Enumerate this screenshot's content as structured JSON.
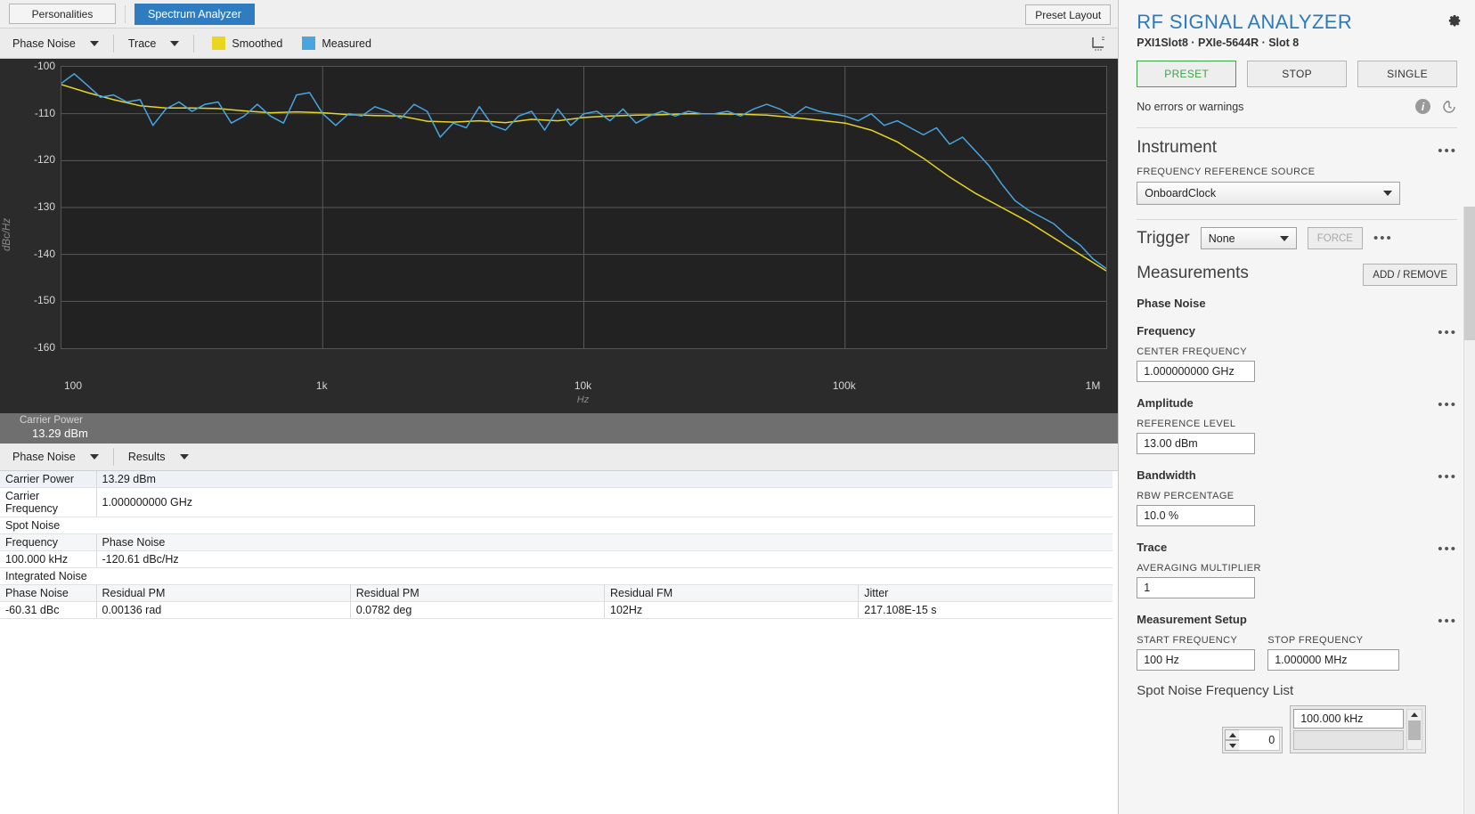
{
  "topbar": {
    "personalities_label": "Personalities",
    "spectrum_analyzer_label": "Spectrum Analyzer",
    "preset_layout_label": "Preset Layout"
  },
  "chart_toolbar": {
    "measurement_dropdown": "Phase Noise",
    "trace_dropdown": "Trace",
    "legend": [
      {
        "label": "Smoothed",
        "color": "#e8d621"
      },
      {
        "label": "Measured",
        "color": "#49a5e0"
      }
    ],
    "cursor_icon": "cursor-legend-icon"
  },
  "chart_data": {
    "type": "line",
    "title": "",
    "xlabel": "Hz",
    "ylabel": "dBc/Hz",
    "xscale": "log",
    "xlim": [
      100,
      1000000
    ],
    "ylim": [
      -160,
      -100
    ],
    "ytick_labels": [
      "-100",
      "-110",
      "-120",
      "-130",
      "-140",
      "-150",
      "-160"
    ],
    "yticks": [
      -100,
      -110,
      -120,
      -130,
      -140,
      -150,
      -160
    ],
    "xtick_labels": [
      "100",
      "1k",
      "10k",
      "100k",
      "1M"
    ],
    "xticks": [
      100,
      1000,
      10000,
      100000,
      1000000
    ],
    "grid": true,
    "legend_position": "toolbar-top",
    "background": "#222222",
    "series": [
      {
        "name": "Measured",
        "color": "#49a5e0",
        "x": [
          100,
          112,
          126,
          141,
          158,
          178,
          200,
          224,
          251,
          282,
          316,
          355,
          398,
          447,
          501,
          562,
          631,
          708,
          794,
          891,
          1000,
          1122,
          1259,
          1413,
          1585,
          1778,
          1995,
          2239,
          2512,
          2818,
          3162,
          3548,
          3981,
          4467,
          5012,
          5623,
          6310,
          7079,
          7943,
          8913,
          10000,
          11220,
          12589,
          14125,
          15849,
          17783,
          19953,
          22387,
          25119,
          28184,
          31623,
          35481,
          39811,
          44668,
          50119,
          56234,
          63096,
          70795,
          79433,
          89125,
          100000,
          112202,
          125893,
          141254,
          158489,
          177828,
          199526,
          223872,
          251189,
          281838,
          316228,
          354813,
          398107,
          446684,
          501187,
          562341,
          630957,
          707946,
          794328,
          891251,
          1000000
        ],
        "y": [
          -103.5,
          -101.5,
          -104.0,
          -106.5,
          -106.0,
          -107.5,
          -107.0,
          -112.5,
          -109.0,
          -107.5,
          -109.5,
          -108.0,
          -107.5,
          -112.0,
          -110.5,
          -108.0,
          -110.5,
          -112.0,
          -106.0,
          -105.5,
          -110.0,
          -112.5,
          -110.0,
          -110.5,
          -108.5,
          -109.5,
          -111.0,
          -108.0,
          -109.5,
          -115.0,
          -112.0,
          -113.0,
          -108.5,
          -112.5,
          -113.5,
          -110.5,
          -109.5,
          -113.5,
          -109.0,
          -112.5,
          -110.0,
          -109.5,
          -111.5,
          -109.0,
          -112.0,
          -110.5,
          -109.5,
          -110.5,
          -109.5,
          -110.0,
          -110.0,
          -109.5,
          -110.5,
          -109.0,
          -108.0,
          -109.0,
          -110.5,
          -108.5,
          -109.5,
          -110.0,
          -110.5,
          -111.5,
          -110.0,
          -112.5,
          -111.5,
          -113.0,
          -114.5,
          -113.0,
          -116.5,
          -115.0,
          -118.0,
          -121.0,
          -125.0,
          -128.5,
          -130.5,
          -132.0,
          -133.5,
          -136.0,
          -138.0,
          -141.0,
          -143.0
        ]
      },
      {
        "name": "Smoothed",
        "color": "#e8d621",
        "x": [
          100,
          126,
          158,
          200,
          251,
          316,
          398,
          501,
          631,
          794,
          1000,
          1259,
          1585,
          1995,
          2512,
          3162,
          3981,
          5012,
          6310,
          7943,
          10000,
          12589,
          15849,
          19953,
          25119,
          31623,
          39811,
          50119,
          63096,
          79433,
          100000,
          125893,
          158489,
          199526,
          251189,
          316228,
          398107,
          501187,
          630957,
          794328,
          1000000
        ],
        "y": [
          -103.8,
          -105.5,
          -107.0,
          -108.3,
          -108.8,
          -108.8,
          -108.9,
          -109.4,
          -109.8,
          -109.6,
          -109.8,
          -110.2,
          -110.4,
          -110.5,
          -111.6,
          -111.8,
          -111.5,
          -111.9,
          -111.2,
          -111.5,
          -110.8,
          -110.5,
          -110.3,
          -110.2,
          -110.0,
          -110.0,
          -110.1,
          -110.3,
          -110.8,
          -111.4,
          -112.0,
          -113.5,
          -116.0,
          -119.5,
          -123.5,
          -127.0,
          -130.0,
          -133.0,
          -136.5,
          -140.0,
          -143.5
        ]
      }
    ]
  },
  "carrier_band": {
    "label": "Carrier Power",
    "value": "13.29 dBm"
  },
  "results_bar": {
    "measurement_dropdown": "Phase Noise",
    "view_dropdown": "Results"
  },
  "results": {
    "summary_rows": [
      {
        "label": "Carrier Power",
        "value": "13.29 dBm"
      },
      {
        "label": "Carrier Frequency",
        "value": "1.000000000 GHz"
      }
    ],
    "spot_noise": {
      "section_title": "Spot Noise",
      "headers": [
        "Frequency",
        "Phase Noise"
      ],
      "rows": [
        [
          "100.000 kHz",
          "-120.61 dBc/Hz"
        ]
      ]
    },
    "integrated_noise": {
      "section_title": "Integrated Noise",
      "headers": [
        "Phase Noise",
        "Residual PM",
        "Residual PM",
        "Residual FM",
        "Jitter"
      ],
      "rows": [
        [
          "-60.31 dBc",
          "0.00136 rad",
          "0.0782 deg",
          "102Hz",
          "217.108E-15 s"
        ]
      ]
    }
  },
  "right_panel": {
    "title": "RF SIGNAL ANALYZER",
    "subtitle": "PXI1Slot8  ·  PXIe-5644R  ·  Slot 8",
    "gear_icon": "gear-icon",
    "buttons": {
      "preset": "PRESET",
      "stop": "STOP",
      "single": "SINGLE"
    },
    "status_text": "No errors or warnings",
    "info_icon": "info-icon",
    "history_icon": "history-icon",
    "instrument": {
      "title": "Instrument",
      "more_icon": "more-options-icon",
      "freq_ref_caption": "FREQUENCY REFERENCE SOURCE",
      "freq_ref_value": "OnboardClock"
    },
    "trigger": {
      "title": "Trigger",
      "type_value": "None",
      "force_label": "FORCE",
      "more_icon": "more-options-icon"
    },
    "measurements": {
      "title": "Measurements",
      "add_remove_label": "ADD / REMOVE",
      "active_measurement": "Phase Noise"
    },
    "frequency": {
      "title": "Frequency",
      "center_caption": "CENTER FREQUENCY",
      "center_value": "1.000000000 GHz"
    },
    "amplitude": {
      "title": "Amplitude",
      "ref_caption": "REFERENCE LEVEL",
      "ref_value": "13.00 dBm"
    },
    "bandwidth": {
      "title": "Bandwidth",
      "rbw_caption": "RBW PERCENTAGE",
      "rbw_value": "10.0 %"
    },
    "trace": {
      "title": "Trace",
      "avg_caption": "AVERAGING MULTIPLIER",
      "avg_value": "1"
    },
    "measurement_setup": {
      "title": "Measurement Setup",
      "start_caption": "START FREQUENCY",
      "start_value": "100 Hz",
      "stop_caption": "STOP FREQUENCY",
      "stop_value": "1.000000 MHz"
    },
    "spot_noise_list": {
      "title": "Spot Noise Frequency List",
      "index_value": "0",
      "items": [
        "100.000 kHz",
        ""
      ]
    },
    "accent_color": "#2e7ab8",
    "preset_color": "#3fa34a"
  }
}
